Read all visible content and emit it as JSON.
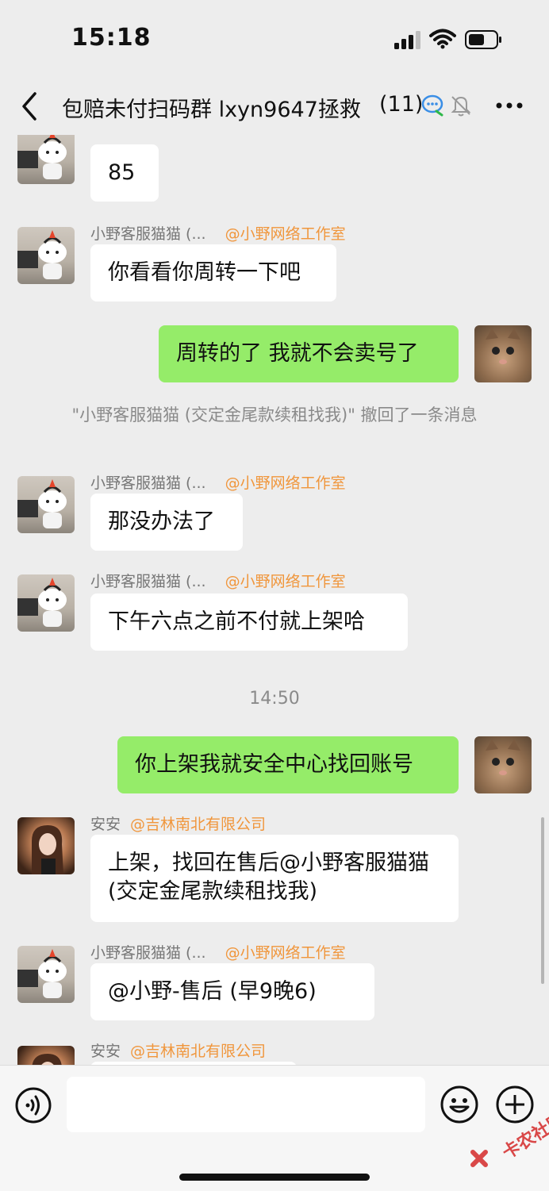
{
  "status_bar": {
    "time": "15:18"
  },
  "header": {
    "title": "包赔未付扫码群 lxyn9647拯救",
    "count": "(11)"
  },
  "messages": {
    "m0": {
      "text": "85"
    },
    "m1": {
      "sender": "小野客服猫猫 (...",
      "org": "@小野网络工作室",
      "text": "你看看你周转一下吧"
    },
    "m2": {
      "text": "周转的了 我就不会卖号了"
    },
    "sys1": {
      "text": "\"小野客服猫猫 (交定金尾款续租找我)\" 撤回了一条消息"
    },
    "m3": {
      "sender": "小野客服猫猫 (...",
      "org": "@小野网络工作室",
      "text": "那没办法了"
    },
    "m4": {
      "sender": "小野客服猫猫 (...",
      "org": "@小野网络工作室",
      "text": "下午六点之前不付就上架哈"
    },
    "ts1": {
      "text": "14:50"
    },
    "m5": {
      "text": "你上架我就安全中心找回账号"
    },
    "m6": {
      "sender": "安安",
      "org": "@吉林南北有限公司",
      "text": "上架，找回在售后@小野客服猫猫 (交定金尾款续租找我)"
    },
    "m7": {
      "sender": "小野客服猫猫 (...",
      "org": "@小野网络工作室",
      "text": "@小野-售后 (早9晚6)"
    },
    "m8": {
      "sender": "安安",
      "org": "@吉林南北有限公司"
    }
  },
  "watermark": {
    "text": "卡农社区"
  },
  "colors": {
    "my_bubble": "#95ec69",
    "other_bubble": "#ffffff",
    "org_tag": "#f0963c",
    "background": "#ededed"
  }
}
